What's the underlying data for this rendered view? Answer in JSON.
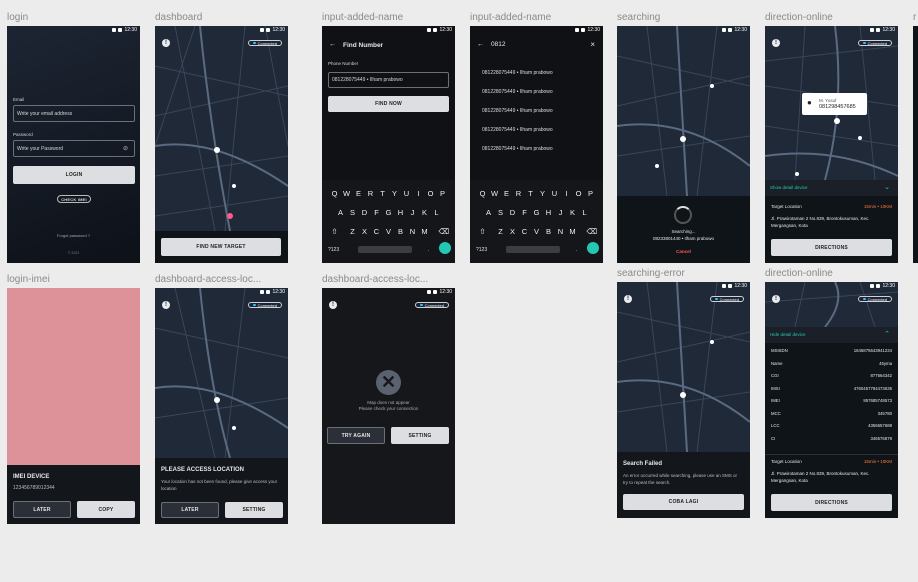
{
  "labels": {
    "login": "login",
    "dashboard": "dashboard",
    "input1": "input-added-name",
    "input2": "input-added-name",
    "searching": "searching",
    "direction1": "direction-online",
    "login_imei": "login-imei",
    "dash_loc": "dashboard-access-loc...",
    "dash_loc2": "dashboard-access-loc...",
    "search_err": "searching-error",
    "direction2": "direction-online",
    "partial": "r"
  },
  "status": {
    "time": "12:30"
  },
  "connected": "Connected",
  "login": {
    "email_label": "Email",
    "email_placeholder": "Write your email address",
    "password_label": "Password",
    "password_placeholder": "Write your Password",
    "login_button": "LOGIN",
    "check_imei": "CHECK IMEI",
    "forgot": "Forgot password ?",
    "version": "© 2023"
  },
  "dashboard": {
    "new_target_button": "FIND NEW TARGET"
  },
  "find_number": {
    "title": "Find Number",
    "phone_label": "Phone Number",
    "phone_value": "081228075449 • Ilham prabowo",
    "find_button": "FIND NOW"
  },
  "search_input": {
    "query": "0812",
    "results": [
      "081228075449 • Ilham prabowo",
      "081228075449 • Ilham prabowo",
      "081228075449 • Ilham prabowo",
      "081228075449 • Ilham prabowo",
      "081228075449 • Ilham prabowo"
    ]
  },
  "keyboard": {
    "row1": [
      "Q",
      "W",
      "E",
      "R",
      "T",
      "Y",
      "U",
      "I",
      "O",
      "P"
    ],
    "row2": [
      "A",
      "S",
      "D",
      "F",
      "G",
      "H",
      "J",
      "K",
      "L"
    ],
    "row3": [
      "Z",
      "X",
      "C",
      "V",
      "B",
      "N",
      "M"
    ],
    "sym": "?123",
    "dot": "."
  },
  "searching": {
    "status": "Searching...",
    "target": "08233801440 • Ilham prabowo",
    "cancel": "Cancel"
  },
  "direction": {
    "popup_name": "M. Yusuf",
    "popup_number": "081298457685",
    "show_detail": "Show detail device",
    "hide_detail": "Hide detail device",
    "target_label": "Target Location",
    "eta": "15min • 10KM",
    "address": "Jl. Prawirotaman 2 No.839, Brontokusuman, Kec. Mergangsan, Kota",
    "directions_button": "DIRECTIONS",
    "details": [
      {
        "k": "MSISDN",
        "v": "1645875643941234"
      },
      {
        "k": "Name",
        "v": "45yma"
      },
      {
        "k": "CGI",
        "v": "877664342"
      },
      {
        "k": "IMSI",
        "v": "4760457784473635"
      },
      {
        "k": "IMEI",
        "v": "857685748573"
      },
      {
        "k": "MCC",
        "v": "345780"
      },
      {
        "k": "LCC",
        "v": "4356657689"
      },
      {
        "k": "CI",
        "v": "346576879"
      }
    ]
  },
  "imei": {
    "title": "IMEI DEVICE",
    "value": "123456789012344",
    "later": "LATER",
    "copy": "COPY"
  },
  "access": {
    "title": "PLEASE ACCESS LOCATION",
    "desc": "Your location has not been found, please give access your location",
    "later": "LATER",
    "setting": "SETTING"
  },
  "map_error": {
    "line1": "Map does not appear",
    "line2": "Please check your connection",
    "try_again": "TRY AGAIN",
    "setting": "SETTING"
  },
  "search_error": {
    "title": "Search Failed",
    "desc": "An error occurred while searching, please use an SMS or try to repeat the search.",
    "retry": "COBA LAGI"
  },
  "colors": {
    "accent": "#36c2ff",
    "eta": "#ff7a3d",
    "cancel": "#ff5b5b",
    "teal": "#23c7b3",
    "imei_bg": "#dd9199"
  }
}
